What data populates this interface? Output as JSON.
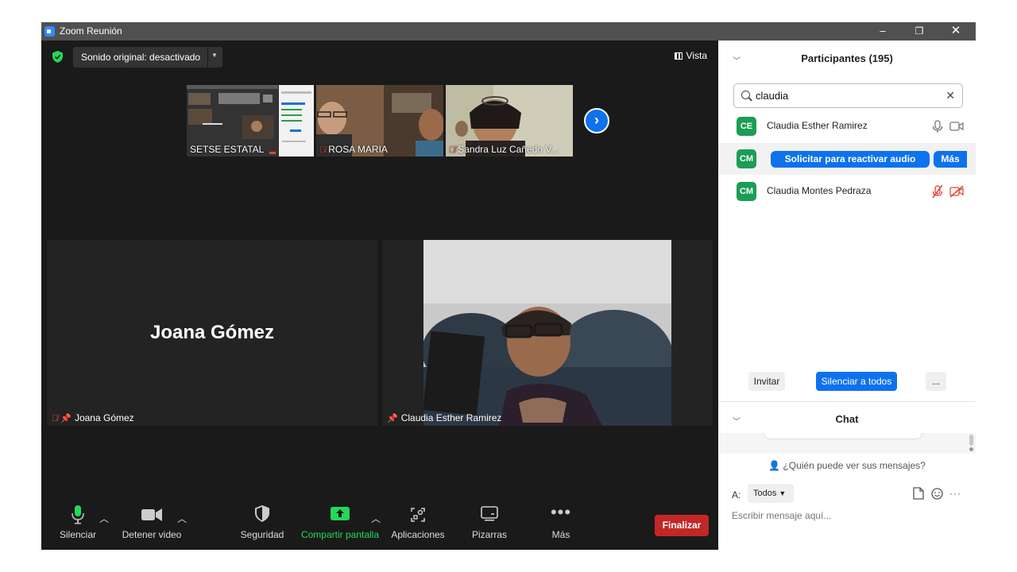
{
  "window": {
    "title": "Zoom Reunión",
    "controls": {
      "minimize": "–",
      "restore": "❐",
      "close": "✕"
    }
  },
  "topbar": {
    "sound_label": "Sonido original: desactivado",
    "view_label": "Vista"
  },
  "thumbnails": [
    {
      "name": "SETSE ESTATAL",
      "muted": false
    },
    {
      "name": "ROSA MARIA",
      "muted": true
    },
    {
      "name": "Sandra Luz Cañedo V...",
      "muted": true
    }
  ],
  "tiles": {
    "left": {
      "big_name": "Joana Gómez",
      "name": "Joana Gómez",
      "muted": true,
      "pinned": true
    },
    "right": {
      "name": "Claudia Esther Ramirez",
      "pinned": true
    }
  },
  "toolbar": {
    "mute": "Silenciar",
    "video": "Detener video",
    "security": "Seguridad",
    "share": "Compartir pantalla",
    "apps": "Aplicaciones",
    "whiteboards": "Pizarras",
    "more": "Más",
    "end": "Finalizar"
  },
  "participants": {
    "title": "Participantes (195)",
    "search_value": "claudia",
    "rows": [
      {
        "initials": "CE",
        "name": "Claudia Esther Ramirez"
      },
      {
        "initials": "CM",
        "request_label": "Solicitar para reactivar audio",
        "more_label": "Más"
      },
      {
        "initials": "CM",
        "name": "Claudia Montes Pedraza"
      }
    ],
    "invite": "Invitar",
    "mute_all": "Silenciar a todos",
    "more": "..."
  },
  "chat": {
    "title": "Chat",
    "who_can_see": "¿Quién puede ver sus mensajes?",
    "to_label": "A:",
    "to_value": "Todos",
    "placeholder": "Escribir mensaje aquí..."
  },
  "colors": {
    "accent": "#0e72ed",
    "end": "#c22727",
    "share": "#22c65a",
    "avatar": "#1a9e54",
    "mute_red": "#e0453a"
  }
}
